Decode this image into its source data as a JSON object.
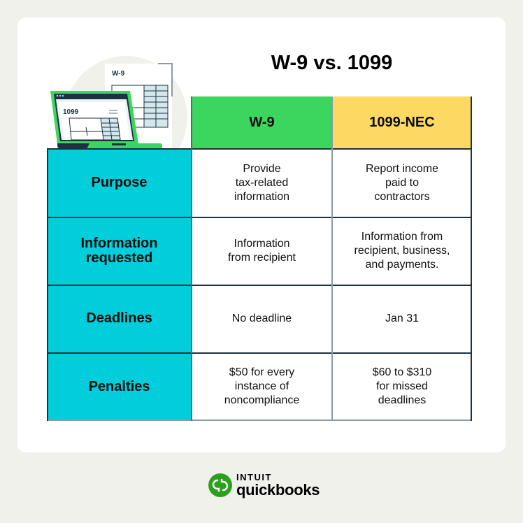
{
  "title": "W-9 vs. 1099",
  "illustration": {
    "back_document_label": "W-9",
    "laptop_screen_label": "1099"
  },
  "table": {
    "columns": [
      "W-9",
      "1099-NEC"
    ],
    "colors": {
      "w9_header": "#3bd65e",
      "nec_header": "#fdd862",
      "row_label_bg": "#00ceda"
    },
    "rows": [
      {
        "label": "Purpose",
        "w9": "Provide\ntax-related\ninformation",
        "nec": "Report income\npaid to\ncontractors"
      },
      {
        "label": "Information\nrequested",
        "w9": "Information\nfrom recipient",
        "nec": "Information from\nrecipient, business,\nand payments."
      },
      {
        "label": "Deadlines",
        "w9": "No deadline",
        "nec": "Jan 31"
      },
      {
        "label": "Penalties",
        "w9": "$50 for every\ninstance of\nnoncompliance",
        "nec": "$60 to $310\nfor missed\ndeadlines"
      }
    ]
  },
  "brand": {
    "company": "INTUIT",
    "product": "quickbooks",
    "color": "#2ca01c"
  }
}
